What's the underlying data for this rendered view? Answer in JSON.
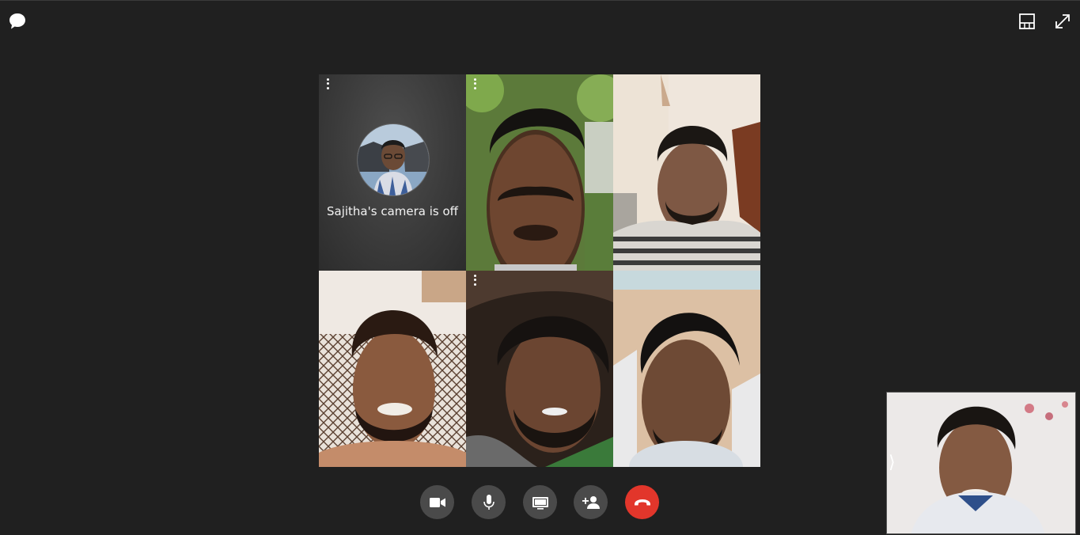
{
  "grid": {
    "tiles": [
      {
        "camera_off_text": "Sajitha's camera is off"
      }
    ]
  },
  "colors": {
    "background": "#202020",
    "control_button": "#4a4a4a",
    "end_call": "#e2362b"
  },
  "icons": {
    "top_left": "chat-icon",
    "top_right": [
      "layout-icon",
      "fullscreen-icon"
    ],
    "controls": [
      "video-camera-icon",
      "microphone-icon",
      "screen-share-icon",
      "add-person-icon",
      "end-call-icon"
    ]
  }
}
